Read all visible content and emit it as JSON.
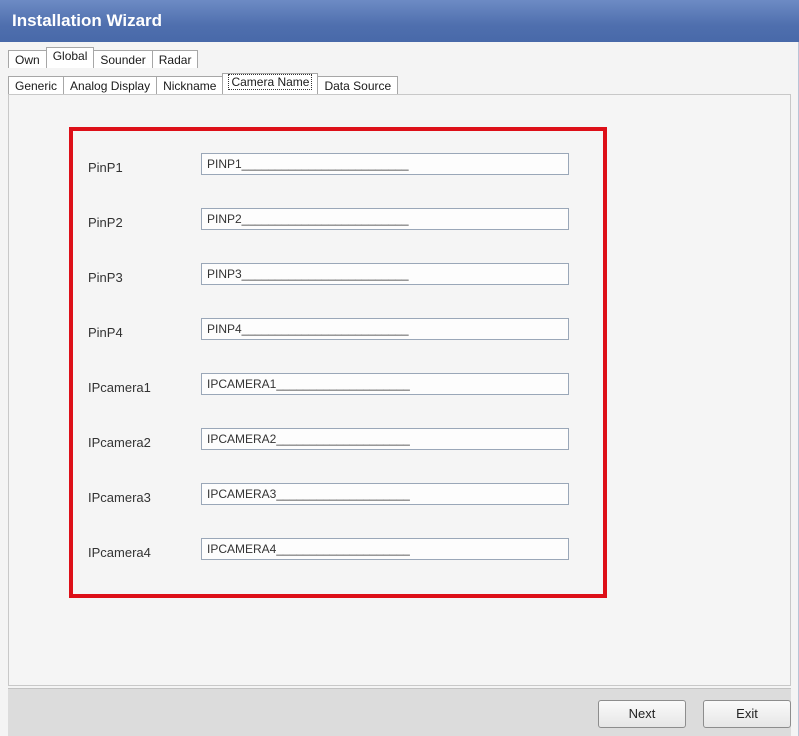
{
  "window": {
    "title": "Installation Wizard"
  },
  "tabs_top": [
    "Own",
    "Global",
    "Sounder",
    "Radar"
  ],
  "tabs_second": [
    "Generic",
    "Analog Display",
    "Nickname",
    "Camera Name",
    "Data Source"
  ],
  "fields": [
    {
      "label": "PinP1",
      "value": "PINP1_________________________"
    },
    {
      "label": "PinP2",
      "value": "PINP2_________________________"
    },
    {
      "label": "PinP3",
      "value": "PINP3_________________________"
    },
    {
      "label": "PinP4",
      "value": "PINP4_________________________"
    },
    {
      "label": "IPcamera1",
      "value": "IPCAMERA1____________________"
    },
    {
      "label": "IPcamera2",
      "value": "IPCAMERA2____________________"
    },
    {
      "label": "IPcamera3",
      "value": "IPCAMERA3____________________"
    },
    {
      "label": "IPcamera4",
      "value": "IPCAMERA4____________________"
    }
  ],
  "buttons": {
    "next": "Next",
    "exit": "Exit"
  },
  "colors": {
    "highlight_box": "#dd0f18",
    "titlebar": "#4f6fae"
  }
}
